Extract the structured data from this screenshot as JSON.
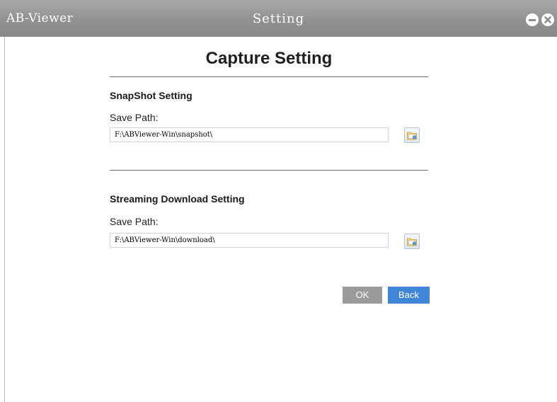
{
  "window": {
    "app_name": "AB-Viewer",
    "title": "Setting",
    "controls": {
      "minimize_icon": "minimize-circle-icon",
      "close_icon": "close-circle-icon"
    }
  },
  "page": {
    "title": "Capture Setting"
  },
  "snapshot": {
    "heading": "SnapShot Setting",
    "label": "Save Path:",
    "value": "F:\\ABViewer-Win\\snapshot\\",
    "browse_icon": "folder-browse-icon"
  },
  "download": {
    "heading": "Streaming Download Setting",
    "label": "Save Path:",
    "value": "F:\\ABViewer-Win\\download\\",
    "browse_icon": "folder-browse-icon"
  },
  "actions": {
    "ok_label": "OK",
    "back_label": "Back"
  },
  "colors": {
    "titlebar": "#8f8f8f",
    "ok_button": "#9b9b9b",
    "back_button": "#3f86d9"
  }
}
